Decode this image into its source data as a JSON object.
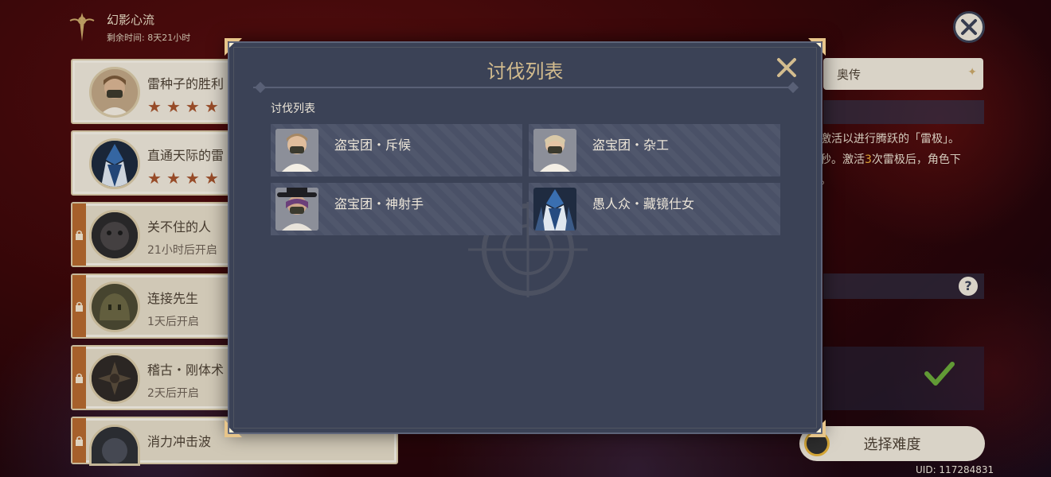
{
  "event": {
    "title": "幻影心流",
    "time_left": "剩余时间: 8天21小时"
  },
  "challenges": [
    {
      "name": "雷种子的胜利",
      "stars": 4,
      "locked": false,
      "icon": "treasure-hoarder-avatar"
    },
    {
      "name": "直通天际的雷",
      "stars": 4,
      "locked": false,
      "icon": "mirror-maiden-avatar"
    },
    {
      "name": "关不住的人",
      "status": "21小时后开启",
      "locked": true,
      "icon": "locked-beast-avatar"
    },
    {
      "name": "连接先生",
      "status": "1天后开启",
      "locked": true,
      "icon": "locked-slime-avatar"
    },
    {
      "name": "稽古・刚体术",
      "status": "2天后开启",
      "locked": true,
      "icon": "locked-samurai-avatar"
    },
    {
      "name": "消力冲击波",
      "locked": true,
      "icon": "locked-golem-avatar"
    }
  ],
  "right_panel": {
    "mode_tab": "奥传",
    "desc_line1": "激活以进行腾跃的「雷极」。",
    "desc_line2_a": "秒。激活",
    "desc_line2_num": "3",
    "desc_line2_b": "次雷极后，角色下",
    "desc_line3": "。",
    "select_button": "选择难度",
    "uid": "UID: 117284831"
  },
  "modal": {
    "title": "讨伐列表",
    "section_label": "讨伐列表",
    "enemies": [
      {
        "name": "盗宝团・斥候",
        "icon": "scout-portrait"
      },
      {
        "name": "盗宝团・杂工",
        "icon": "handyman-portrait"
      },
      {
        "name": "盗宝团・神射手",
        "icon": "marksman-portrait"
      },
      {
        "name": "愚人众・藏镜仕女",
        "icon": "mirror-maiden-portrait"
      }
    ]
  },
  "colors": {
    "accent_gold": "#d3bc8e",
    "star_brown": "#a4522c",
    "lock_orange": "#b5692f",
    "modal_bg": "#3b4256",
    "highlight": "#f0b23c"
  }
}
